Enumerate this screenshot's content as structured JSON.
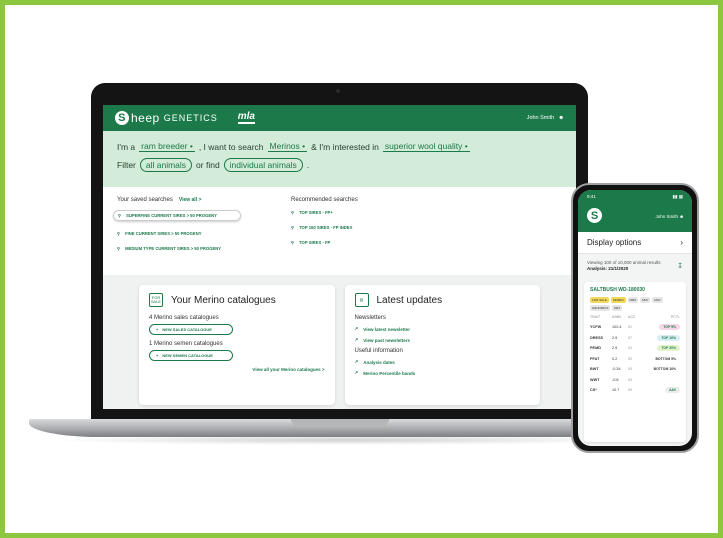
{
  "app": {
    "brand": "heep",
    "brand_suffix": "GENETICS",
    "partner_logo": "mla",
    "user": "John Smith"
  },
  "hero": {
    "im_a": "I'm a",
    "role": "ram breeder",
    "want_search": ", I want to search",
    "breed": "Merinos",
    "interested": "& I'm interested in",
    "interest": "superior wool quality",
    "filter": "Filter",
    "all_animals": "all animals",
    "or_find": "or find",
    "individual_animals": "individual animals",
    "period": "."
  },
  "saved": {
    "title": "Your saved searches",
    "view_all": "View all >",
    "items": [
      "SUPERFINE CURRENT SIRES > 50 PROGENY",
      "FINE CURRENT SIRES > 50 PROGENY",
      "MEDIUM TYPE CURRENT SIRES > 50 PROGENY"
    ]
  },
  "recommended": {
    "title": "Recommended searches",
    "items": [
      "TOP SIRES - FP+",
      "TOP 150 SIRES - FP INDEX",
      "TOP SIRES - FP"
    ]
  },
  "catalogues": {
    "icon_text": "FOR SALE",
    "title": "Your Merino catalogues",
    "sales_count": "4 Merino sales catalogues",
    "new_sales": "NEW SALES CATALOGUE",
    "semen_count": "1 Merino semen catalogues",
    "new_semen": "NEW SEMEN CATALOGUE",
    "view_all": "View all your Merino catalogues >"
  },
  "updates": {
    "title": "Latest updates",
    "newsletters": "Newsletters",
    "latest": "View latest newsletter",
    "past": "View past newsletters",
    "useful": "Useful information",
    "analysis_dates": "Analysis dates",
    "percentile": "Merino Percentile bands"
  },
  "phone": {
    "time": "9:41",
    "user": "John Smith",
    "display_options": "Display options",
    "viewing": "Viewing 100 of 10,000 animal results",
    "analysis_label": "Analysis:",
    "analysis_date": "21/1/2020",
    "animal": "SALTBUSH WD-180030",
    "tags": [
      "FOR SALE",
      "SEMEN",
      "MRS",
      "MLP",
      "MLP",
      "GENOMICS",
      "RET"
    ],
    "headers": [
      "TRAIT",
      "ASBV",
      "ACC",
      "PCTL"
    ],
    "rows": [
      {
        "trait": "YCFW",
        "asbv": "102.4",
        "acc": "80",
        "rank": "TOP 5%",
        "color": "#f6d6e8"
      },
      {
        "trait": "DRESS",
        "asbv": "2.9",
        "acc": "87",
        "rank": "TOP 10%",
        "color": "#d7eef7"
      },
      {
        "trait": "PEMD",
        "asbv": "2.9",
        "acc": "84",
        "rank": "TOP 20%",
        "color": "#e3f3c9"
      },
      {
        "trait": "PFAT",
        "asbv": "0.2",
        "acc": "85",
        "rank": "BOTTOM 5%",
        "color": "#ffffff"
      },
      {
        "trait": "BWT",
        "asbv": "-0.34",
        "acc": "85",
        "rank": "BOTTOM 10%",
        "color": "#ffffff"
      },
      {
        "trait": "WWT",
        "asbv": "-0.8",
        "acc": "85",
        "rank": "",
        "color": "#ffffff"
      },
      {
        "trait": "CS*",
        "asbv": "10.7",
        "acc": "85",
        "rank": "AAV",
        "color": "#ececec"
      }
    ]
  }
}
